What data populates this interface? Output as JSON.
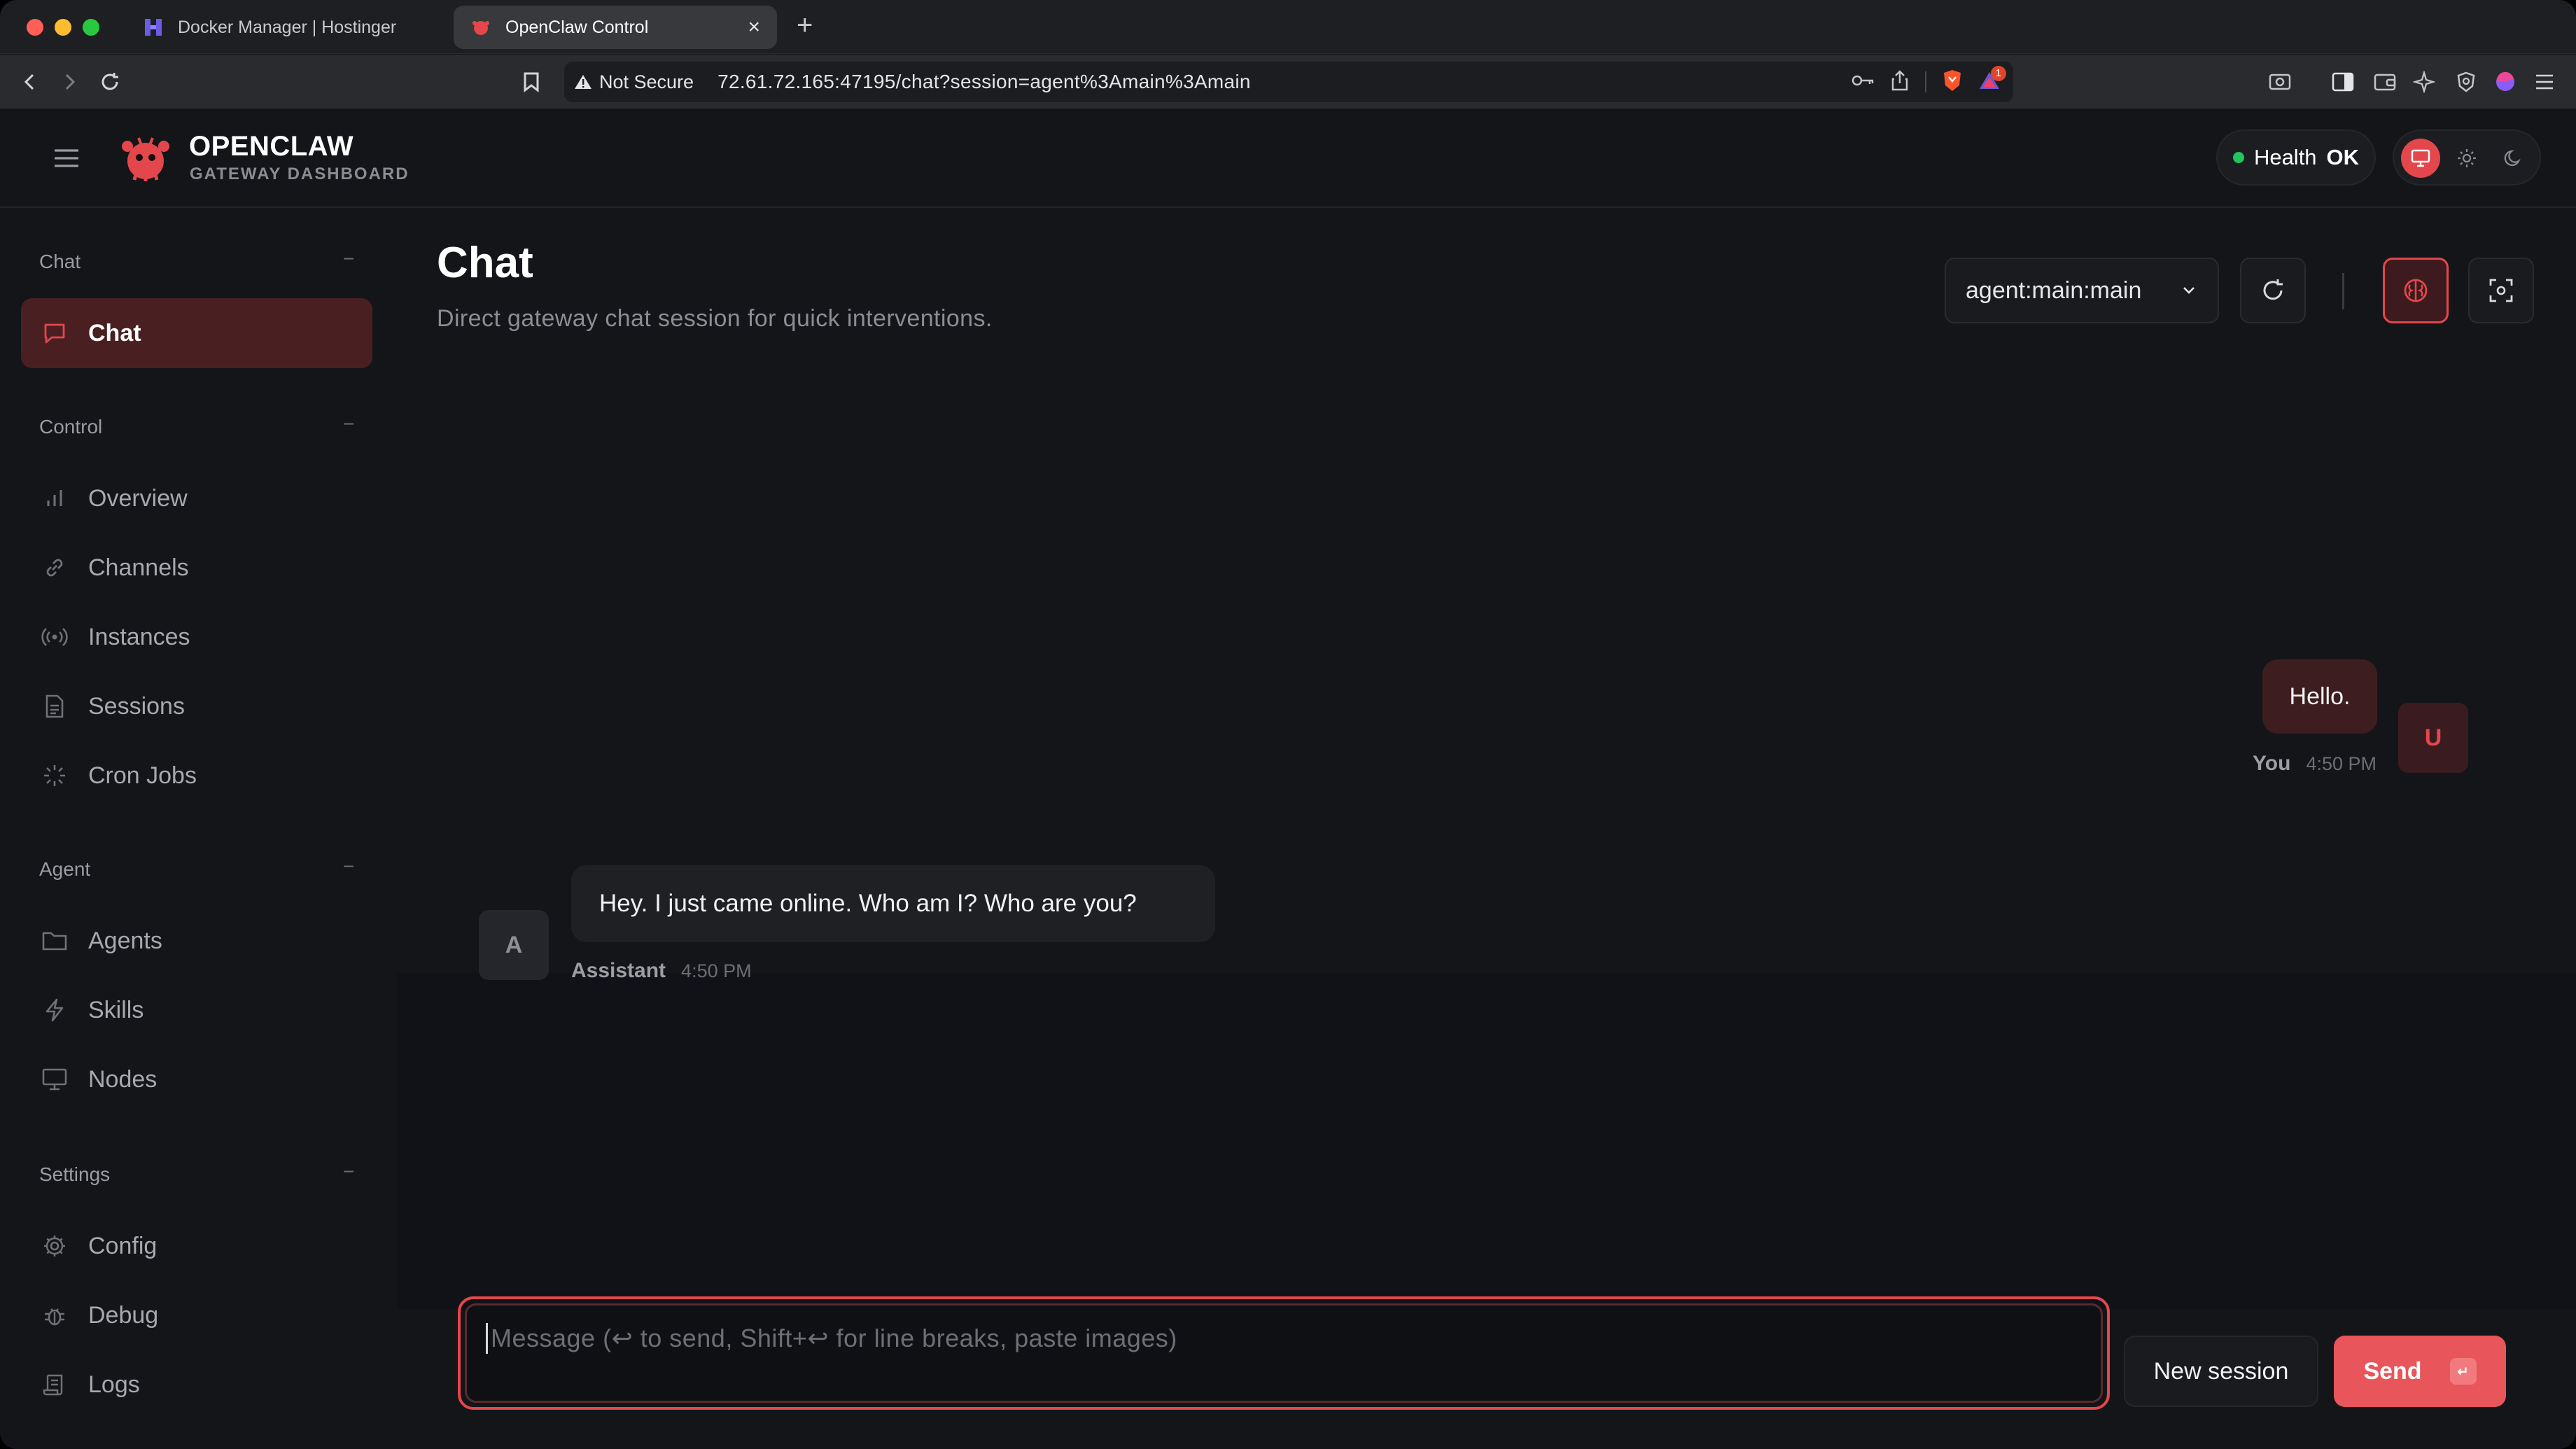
{
  "browser": {
    "tabs": [
      {
        "title": "Docker Manager | Hostinger",
        "icon": "hostinger-icon"
      },
      {
        "title": "OpenClaw Control",
        "icon": "openclaw-icon"
      }
    ],
    "security_label": "Not Secure",
    "url": "72.61.72.165:47195/chat?session=agent%3Amain%3Amain",
    "notification_count": "1"
  },
  "header": {
    "brand_title": "OPENCLAW",
    "brand_subtitle": "GATEWAY DASHBOARD",
    "health_label": "Health",
    "health_status": "OK"
  },
  "sidebar": {
    "groups": [
      {
        "label": "Chat",
        "items": [
          {
            "label": "Chat",
            "icon": "message-square-icon",
            "active": true
          }
        ]
      },
      {
        "label": "Control",
        "items": [
          {
            "label": "Overview",
            "icon": "bar-chart-icon"
          },
          {
            "label": "Channels",
            "icon": "link-icon"
          },
          {
            "label": "Instances",
            "icon": "radio-icon"
          },
          {
            "label": "Sessions",
            "icon": "file-text-icon"
          },
          {
            "label": "Cron Jobs",
            "icon": "loader-icon"
          }
        ]
      },
      {
        "label": "Agent",
        "items": [
          {
            "label": "Agents",
            "icon": "folder-icon"
          },
          {
            "label": "Skills",
            "icon": "zap-icon"
          },
          {
            "label": "Nodes",
            "icon": "monitor-icon"
          }
        ]
      },
      {
        "label": "Settings",
        "items": [
          {
            "label": "Config",
            "icon": "settings-icon"
          },
          {
            "label": "Debug",
            "icon": "bug-icon"
          },
          {
            "label": "Logs",
            "icon": "scroll-icon"
          }
        ]
      }
    ],
    "collapse_glyph": "−"
  },
  "main": {
    "title": "Chat",
    "subtitle": "Direct gateway chat session for quick interventions.",
    "session_value": "agent:main:main"
  },
  "messages": [
    {
      "role": "user",
      "text": "Hello.",
      "sender": "You",
      "time": "4:50 PM",
      "avatar": "U"
    },
    {
      "role": "assistant",
      "text": "Hey. I just came online. Who am I? Who are you?",
      "sender": "Assistant",
      "time": "4:50 PM",
      "avatar": "A"
    }
  ],
  "composer": {
    "placeholder": "Message (↩ to send, Shift+↩ for line breaks, paste images)",
    "new_session_label": "New session",
    "send_label": "Send",
    "send_shortcut": "↵"
  },
  "colors": {
    "accent": "#e3474c",
    "health_ok": "#22c55e"
  }
}
